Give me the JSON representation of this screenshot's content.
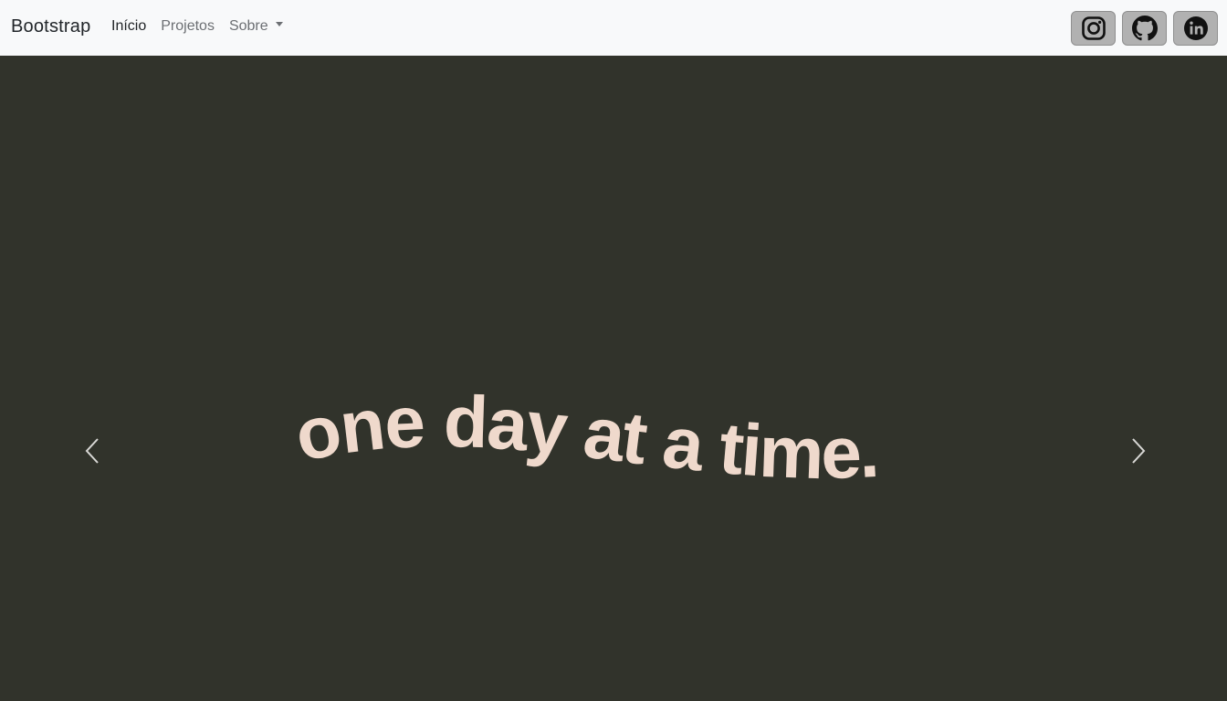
{
  "navbar": {
    "brand": "Bootstrap",
    "links": [
      {
        "label": "Início",
        "active": true
      },
      {
        "label": "Projetos",
        "active": false
      },
      {
        "label": "Sobre",
        "active": false,
        "dropdown": true
      }
    ],
    "social": [
      {
        "name": "instagram-icon"
      },
      {
        "name": "github-icon"
      },
      {
        "name": "linkedin-icon"
      }
    ]
  },
  "loader": {
    "progress": 0.2
  },
  "carousel": {
    "slide_text": "one day at a time.",
    "prev_icon": "chevron-left-icon",
    "next_icon": "chevron-right-icon"
  },
  "colors": {
    "navbar_bg": "#f8f9fa",
    "carousel_bg": "#31332b",
    "slide_text": "#efd9cc",
    "social_btn_bg": "#b1b1b1"
  }
}
